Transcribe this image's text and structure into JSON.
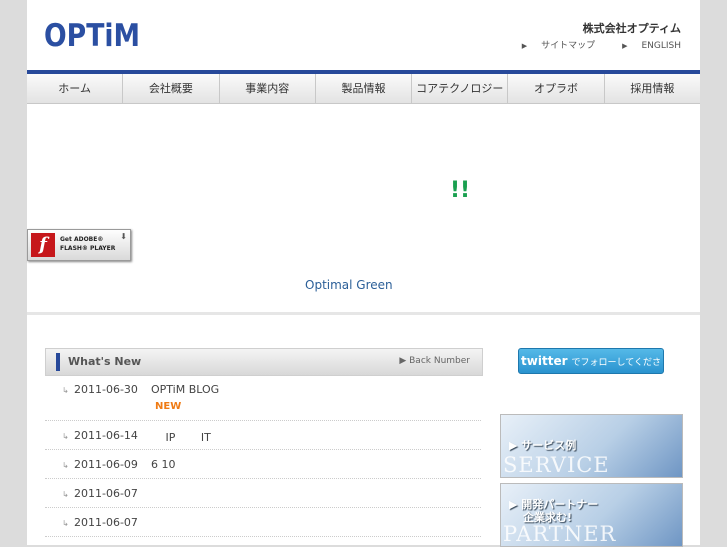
{
  "header": {
    "logo": "OPTiM",
    "company_name": "株式会社オプティム",
    "links": [
      "サイトマップ",
      "ENGLISH"
    ]
  },
  "nav": [
    "ホーム",
    "会社概要",
    "事業内容",
    "製品情報",
    "コアテクノロジー",
    "オプラボ",
    "採用情報"
  ],
  "hero": {
    "exclaim": "!!",
    "flash_badge": [
      "Get ADOBE®",
      "FLASH® PLAYER"
    ],
    "tagline": "Optimal Green"
  },
  "whats_new": {
    "title": "What's New",
    "back_number": "Back Number",
    "items": [
      {
        "date": "2011-06-30",
        "text": "OPTiM BLOG",
        "badge": "NEW"
      },
      {
        "date": "2011-06-14",
        "text": "　 IP 　　IT"
      },
      {
        "date": "2011-06-09",
        "text": "6 10"
      },
      {
        "date": "2011-06-07",
        "text": ""
      },
      {
        "date": "2011-06-07",
        "text": ""
      }
    ]
  },
  "sidebar": {
    "twitter_logo": "twitter",
    "twitter_text": "でフォローしてください!",
    "service_label": "▶ サービス例",
    "service_big": "SERVICE",
    "partner_label_1": "▶ 開発パートナー",
    "partner_label_2": "企業求む!",
    "partner_big": "PARTNER"
  },
  "colors": {
    "brand": "#2b4fa2",
    "accent_green": "#1aa050",
    "new_badge": "#ef7b14"
  }
}
